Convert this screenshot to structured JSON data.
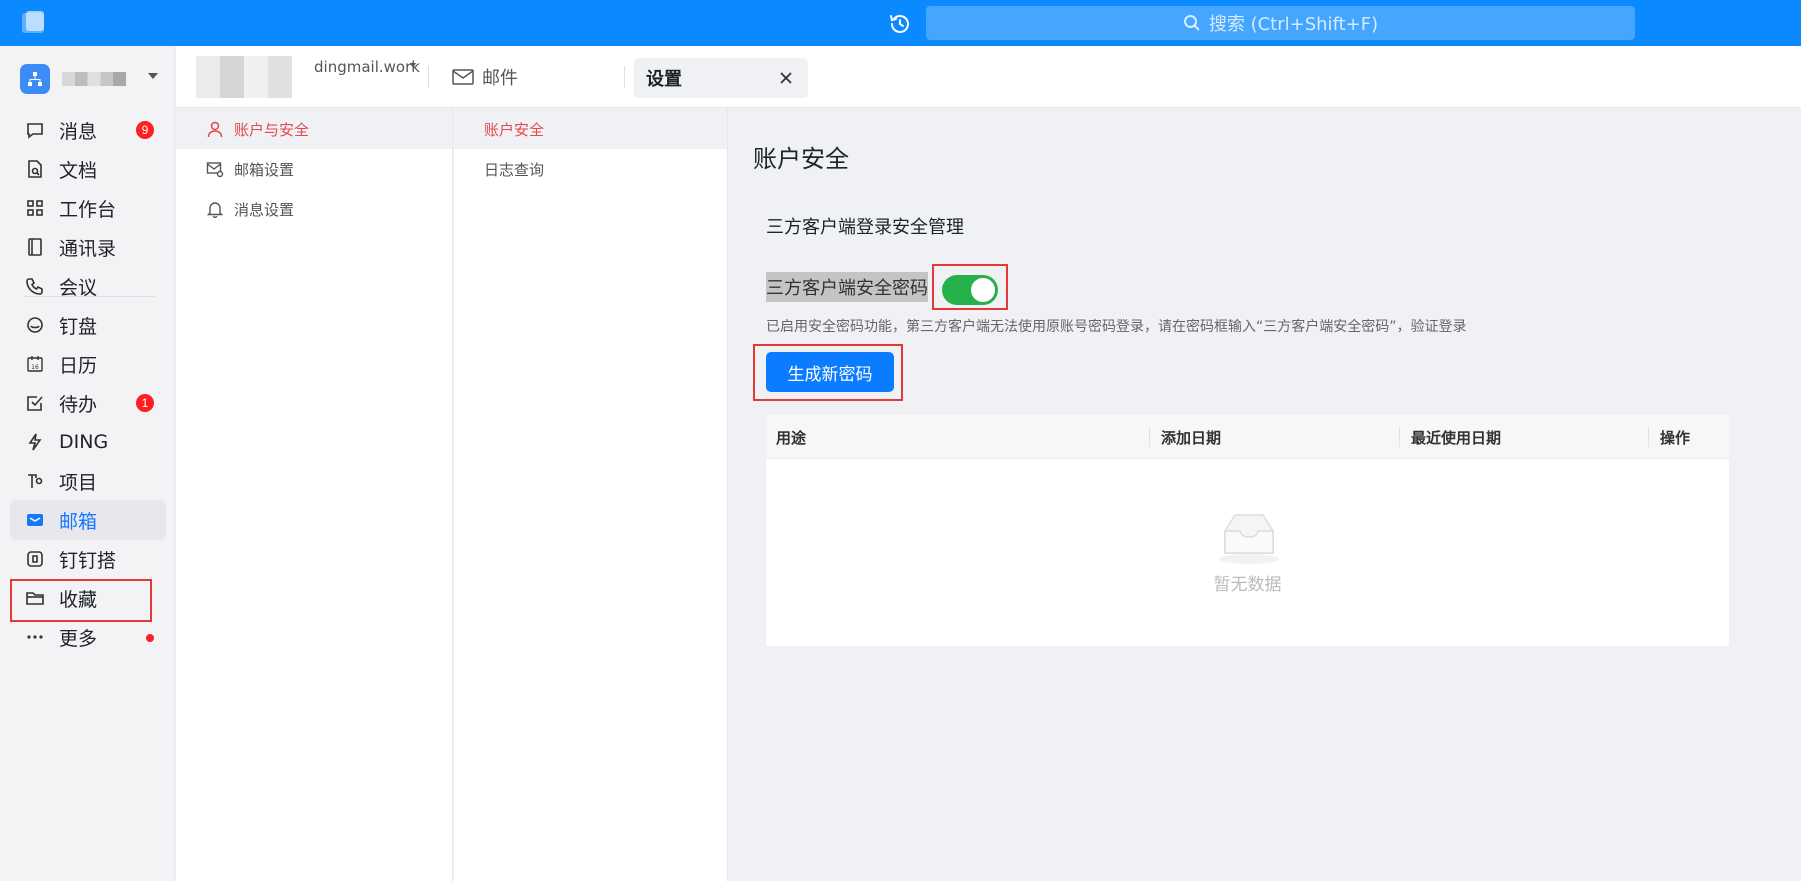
{
  "search": {
    "placeholder": "搜索 (Ctrl+Shift+F)"
  },
  "leftnav": {
    "items": [
      {
        "label": "消息",
        "icon": "chat-icon",
        "badge": "9"
      },
      {
        "label": "文档",
        "icon": "document-icon"
      },
      {
        "label": "工作台",
        "icon": "grid-icon"
      },
      {
        "label": "通讯录",
        "icon": "contacts-icon"
      },
      {
        "label": "会议",
        "icon": "phone-icon"
      },
      {
        "label": "钉盘",
        "icon": "cloud-drive-icon"
      },
      {
        "label": "日历",
        "icon": "calendar-icon",
        "icon_text": "16"
      },
      {
        "label": "待办",
        "icon": "todo-icon",
        "badge": "1"
      },
      {
        "label": "DING",
        "icon": "lightning-icon"
      },
      {
        "label": "项目",
        "icon": "project-icon"
      },
      {
        "label": "邮箱",
        "icon": "mail-icon",
        "active": true
      },
      {
        "label": "钉钉搭",
        "icon": "builder-icon"
      },
      {
        "label": "收藏",
        "icon": "folder-icon"
      },
      {
        "label": "更多",
        "icon": "more-icon",
        "dot": true
      }
    ]
  },
  "mailheader": {
    "account_domain": "dingmail.work",
    "mail_label": "邮件",
    "settings_tab": "设置"
  },
  "settings_menu": {
    "items": [
      {
        "label": "账户与安全",
        "icon": "user-icon",
        "active": true
      },
      {
        "label": "邮箱设置",
        "icon": "mail-settings-icon"
      },
      {
        "label": "消息设置",
        "icon": "bell-icon"
      }
    ]
  },
  "submenu": {
    "items": [
      {
        "label": "账户安全",
        "active": true
      },
      {
        "label": "日志查询"
      }
    ]
  },
  "content": {
    "title": "账户安全",
    "section_title": "三方客户端登录安全管理",
    "switch_label": "三方客户端安全密码",
    "switch_on": true,
    "hint": "已启用安全密码功能，第三方客户端无法使用原账号密码登录，请在密码框输入“三方客户端安全密码”，验证登录",
    "generate_button": "生成新密码",
    "table": {
      "columns": [
        "用途",
        "添加日期",
        "最近使用日期",
        "操作"
      ],
      "empty_text": "暂无数据"
    }
  },
  "colors": {
    "topbar": "#0b8aff",
    "accent": "#1677ff",
    "toggle_on": "#27b14c",
    "badge": "#ff1f1f",
    "active_menu_text": "#e5484d",
    "highlight_border": "#e53935"
  }
}
